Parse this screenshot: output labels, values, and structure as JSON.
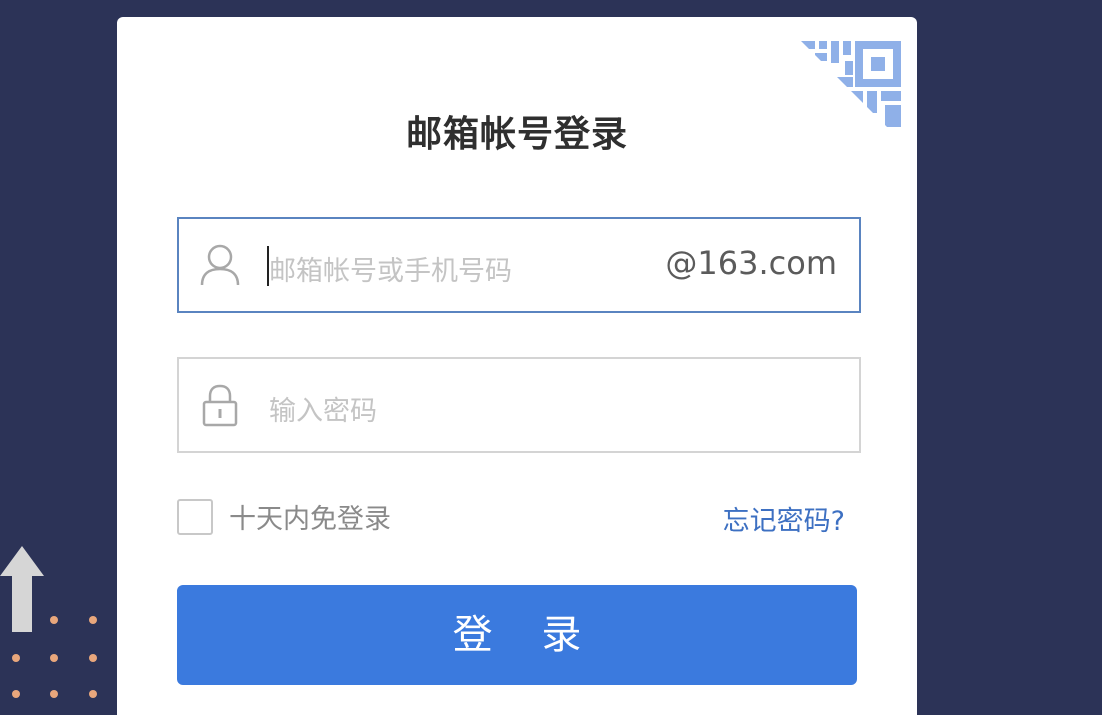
{
  "login": {
    "title": "邮箱帐号登录",
    "username": {
      "placeholder": "邮箱帐号或手机号码",
      "suffix": "@163.com",
      "icon": "user-icon"
    },
    "password": {
      "placeholder": "输入密码",
      "icon": "lock-icon"
    },
    "remember_label": "十天内免登录",
    "forgot_label": "忘记密码?",
    "submit_label": "登 录",
    "qr_icon": "qr-code-icon"
  },
  "colors": {
    "background": "#2c3357",
    "card": "#ffffff",
    "accent": "#3b7ade",
    "link": "#3d70c2",
    "qr": "#8fb0e8",
    "dots": "#e9a77c"
  }
}
